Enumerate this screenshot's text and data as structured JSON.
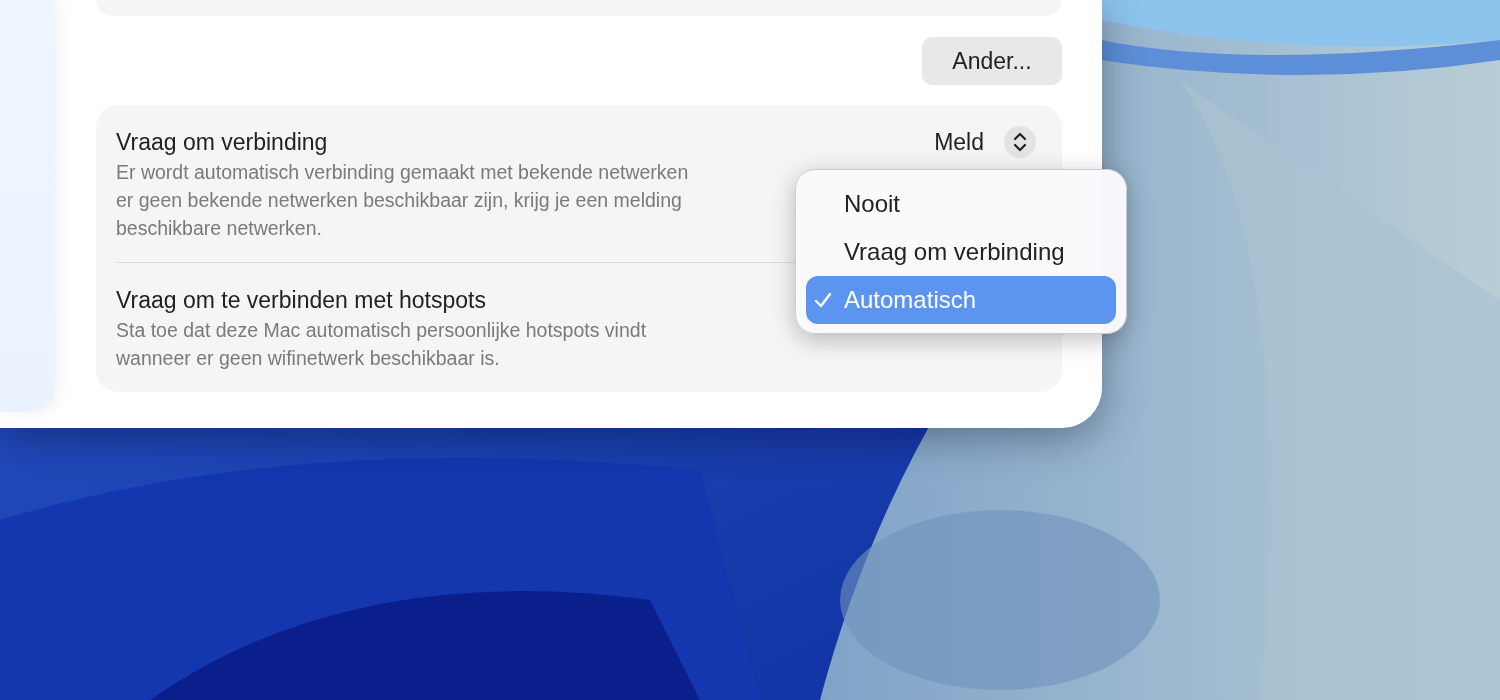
{
  "other_button": {
    "label": "Ander..."
  },
  "settings": [
    {
      "kind": "popup",
      "title": "Vraag om verbinding",
      "description_lines": [
        "Er wordt automatisch verbinding gemaakt met bekende netwerken",
        "er geen bekende netwerken beschikbaar zijn, krijg je een melding",
        "beschikbare netwerken."
      ],
      "value": "Meld"
    },
    {
      "kind": "plain",
      "title": "Vraag om te verbinden met hotspots",
      "description_lines": [
        "Sta toe dat deze Mac automatisch persoonlijke hotspots vindt",
        "wanneer er geen wifinetwerk beschikbaar is."
      ]
    }
  ],
  "menu": {
    "items": [
      {
        "label": "Nooit",
        "selected": false
      },
      {
        "label": "Vraag om verbinding",
        "selected": false
      },
      {
        "label": "Automatisch",
        "selected": true
      }
    ]
  }
}
